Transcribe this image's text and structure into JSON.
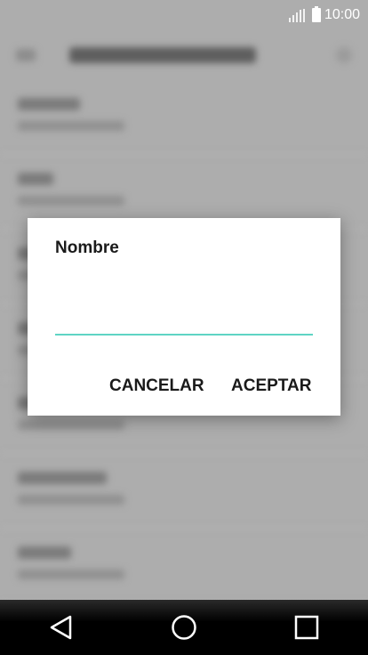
{
  "status_bar": {
    "time": "10:00",
    "signal_icon": "signal-icon",
    "battery_icon": "battery-icon"
  },
  "dialog": {
    "title": "Nombre",
    "input_value": "",
    "cancel_label": "CANCELAR",
    "accept_label": "ACEPTAR",
    "accent_color": "#5fd4c4"
  },
  "nav_bar": {
    "back_icon": "back-icon",
    "home_icon": "home-icon",
    "recents_icon": "recents-icon"
  }
}
